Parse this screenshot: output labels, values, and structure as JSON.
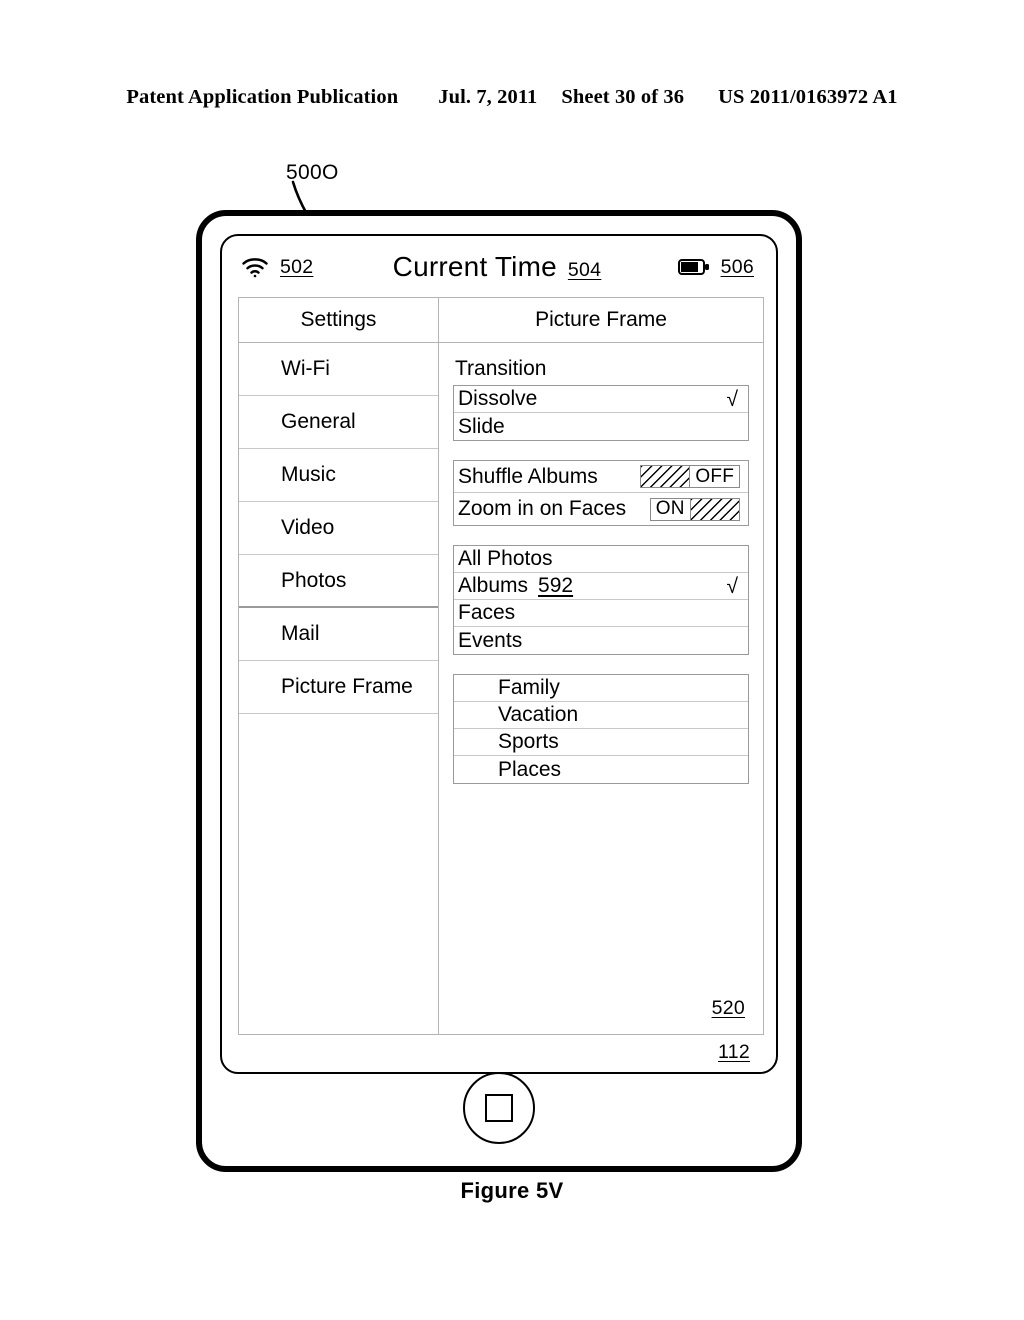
{
  "publication_header": {
    "left": "Patent Application Publication",
    "date": "Jul. 7, 2011",
    "sheet": "Sheet 30 of 36",
    "number": "US 2011/0163972 A1"
  },
  "figure": {
    "caption": "Figure 5V",
    "callout": "500O",
    "device_ref": "112",
    "panel_ref": "520"
  },
  "status_bar": {
    "wifi_icon": "wifi-icon",
    "wifi_ref": "502",
    "title": "Current Time",
    "title_ref": "504",
    "battery_icon": "battery-icon",
    "battery_ref": "506"
  },
  "sidebar": {
    "header": "Settings",
    "items": [
      {
        "label": "Wi-Fi"
      },
      {
        "label": "General"
      },
      {
        "label": "Music"
      },
      {
        "label": "Video"
      },
      {
        "label": "Photos"
      },
      {
        "label": "Mail"
      },
      {
        "label": "Picture Frame"
      }
    ]
  },
  "detail": {
    "header": "Picture Frame",
    "transition": {
      "label": "Transition",
      "options": [
        {
          "label": "Dissolve",
          "check": "√"
        },
        {
          "label": "Slide",
          "check": ""
        }
      ]
    },
    "switches": [
      {
        "label": "Shuffle Albums",
        "state": "OFF",
        "state_label": "OFF"
      },
      {
        "label": "Zoom in on Faces",
        "state": "ON",
        "state_label": "ON"
      }
    ],
    "sources": [
      {
        "label": "All Photos",
        "ref": "",
        "check": ""
      },
      {
        "label": "Albums",
        "ref": "592",
        "check": "√"
      },
      {
        "label": "Faces",
        "ref": "",
        "check": ""
      },
      {
        "label": "Events",
        "ref": "",
        "check": ""
      }
    ],
    "albums": [
      {
        "label": "Family"
      },
      {
        "label": "Vacation"
      },
      {
        "label": "Sports"
      },
      {
        "label": "Places"
      }
    ]
  }
}
